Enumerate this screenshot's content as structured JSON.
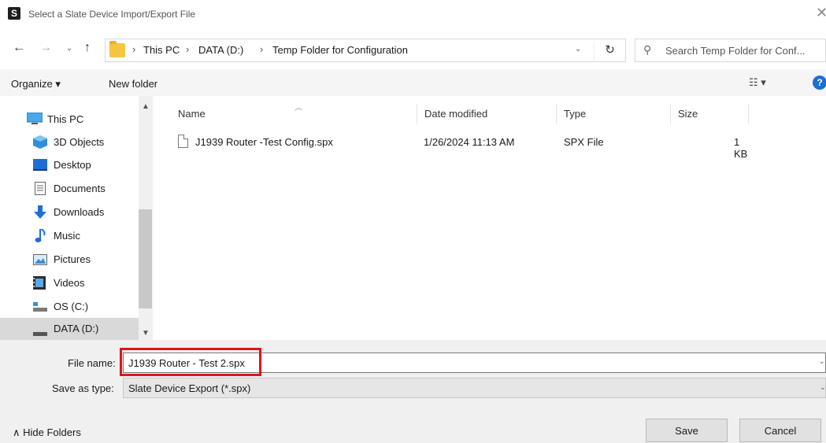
{
  "window": {
    "app_icon_letter": "S",
    "title": "Select a Slate Device Import/Export File",
    "close_glyph": "✕"
  },
  "nav": {
    "back_glyph": "←",
    "forward_glyph": "→",
    "recent_glyph": "⌄",
    "up_glyph": "↑",
    "refresh_glyph": "↻"
  },
  "address": {
    "crumbs": [
      "This PC",
      "DATA (D:)",
      "Temp Folder for Configuration"
    ],
    "separator": "›"
  },
  "search": {
    "placeholder": "Search Temp Folder for Conf..."
  },
  "toolbar": {
    "organize_label": "Organize ▾",
    "new_folder_label": "New folder",
    "view_glyph": "☷ ▾",
    "help_glyph": "?"
  },
  "sidebar": {
    "items": [
      {
        "label": "This PC",
        "icon": "computer-icon"
      },
      {
        "label": "3D Objects",
        "icon": "cube-icon"
      },
      {
        "label": "Desktop",
        "icon": "desktop-icon"
      },
      {
        "label": "Documents",
        "icon": "documents-icon"
      },
      {
        "label": "Downloads",
        "icon": "download-icon"
      },
      {
        "label": "Music",
        "icon": "music-icon"
      },
      {
        "label": "Pictures",
        "icon": "pictures-icon"
      },
      {
        "label": "Videos",
        "icon": "videos-icon"
      },
      {
        "label": "OS (C:)",
        "icon": "drive-icon"
      },
      {
        "label": "DATA (D:)",
        "icon": "drive-icon"
      }
    ],
    "selected_label": "DATA (D:)"
  },
  "file_list": {
    "columns": [
      "Name",
      "Date modified",
      "Type",
      "Size"
    ],
    "rows": [
      {
        "name": "J1939 Router -Test Config.spx",
        "date": "1/26/2024 11:13 AM",
        "type": "SPX File",
        "size": "1 KB"
      }
    ]
  },
  "footer": {
    "file_name_label": "File name:",
    "file_name_value": "J1939 Router - Test 2.spx",
    "save_type_label": "Save as type:",
    "save_type_value": "Slate Device Export (*.spx)",
    "hide_folders_label": "Hide Folders",
    "save_label": "Save",
    "cancel_label": "Cancel"
  },
  "colors": {
    "highlight": "#e0141b",
    "accent": "#1d6fd6",
    "folder": "#f5c542"
  }
}
